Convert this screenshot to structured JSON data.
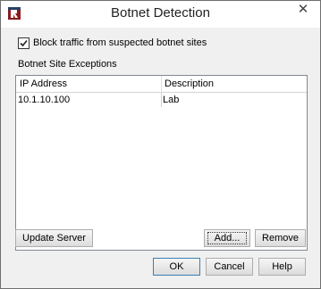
{
  "window": {
    "title": "Botnet Detection",
    "close_label": "✕"
  },
  "block_checkbox": {
    "checked": true,
    "label": "Block traffic from suspected botnet sites"
  },
  "exceptions": {
    "section_label": "Botnet Site Exceptions",
    "columns": [
      "IP Address",
      "Description"
    ],
    "rows": [
      {
        "ip": "10.1.10.100",
        "description": "Lab"
      }
    ]
  },
  "buttons": {
    "update_server": "Update Server",
    "add": "Add...",
    "remove": "Remove",
    "ok": "OK",
    "cancel": "Cancel",
    "help": "Help"
  },
  "icons": {
    "app": "watchguard-logo-icon",
    "check": "checkmark-icon",
    "close": "close-icon"
  }
}
